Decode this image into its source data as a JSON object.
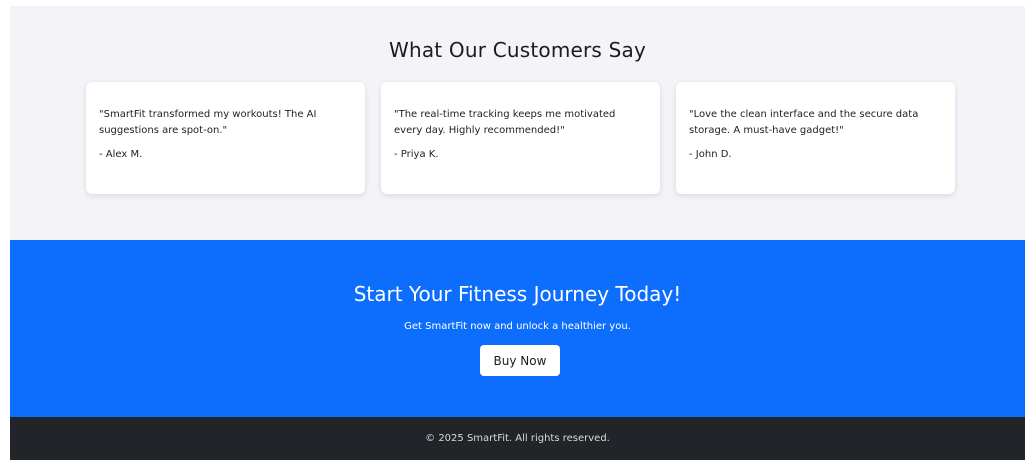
{
  "testimonials": {
    "heading": "What Our Customers Say",
    "items": [
      {
        "quote": "\"SmartFit transformed my workouts! The AI suggestions are spot-on.\"",
        "author": "- Alex M."
      },
      {
        "quote": "\"The real-time tracking keeps me motivated every day. Highly recommended!\"",
        "author": "- Priya K."
      },
      {
        "quote": "\"Love the clean interface and the secure data storage. A must-have gadget!\"",
        "author": "- John D."
      }
    ]
  },
  "cta": {
    "heading": "Start Your Fitness Journey Today!",
    "subtext": "Get SmartFit now and unlock a healthier you.",
    "button_label": "Buy Now"
  },
  "footer": {
    "text": "© 2025 SmartFit. All rights reserved."
  },
  "colors": {
    "testimonials_bg": "#f4f3f8",
    "cta_bg": "#0d6efd",
    "footer_bg": "#212529"
  }
}
